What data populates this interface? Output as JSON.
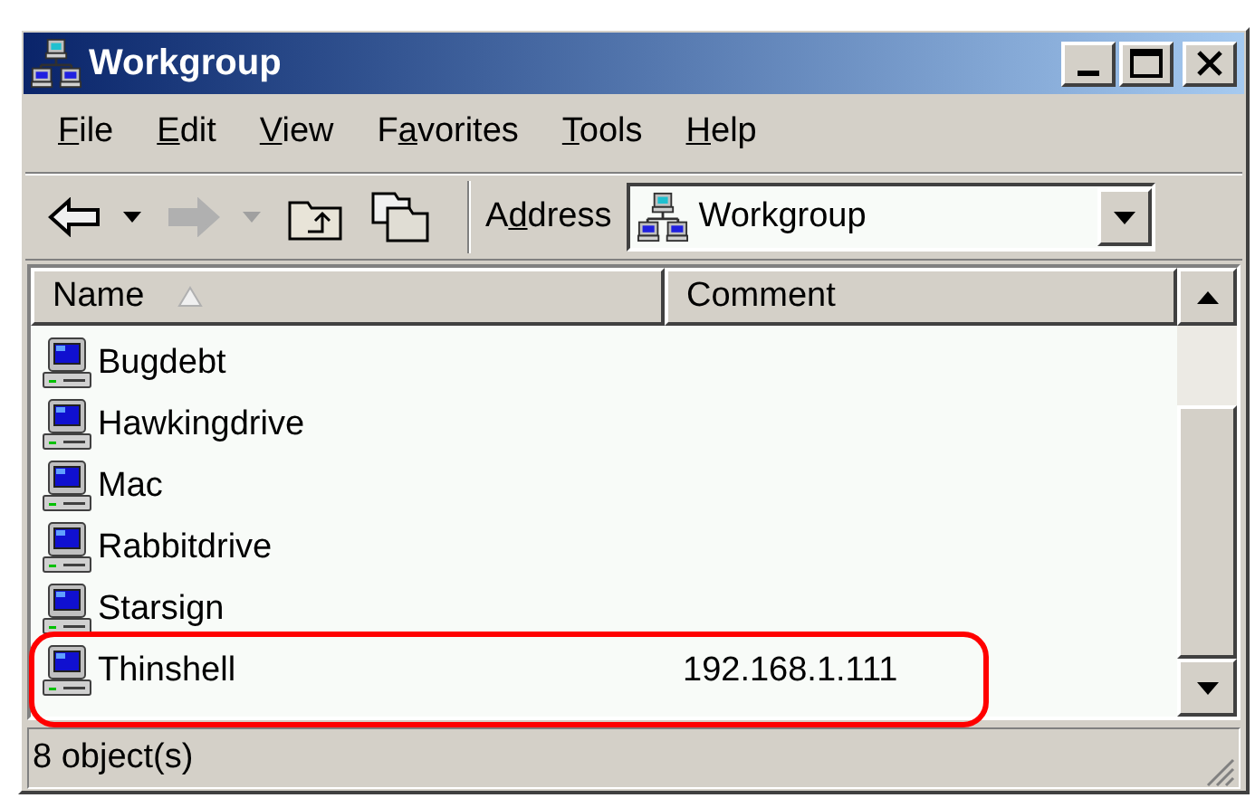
{
  "window": {
    "title": "Workgroup"
  },
  "menu": [
    {
      "key": "F",
      "rest": "ile"
    },
    {
      "key": "E",
      "rest": "dit"
    },
    {
      "key": "V",
      "rest": "iew"
    },
    {
      "start": "F",
      "key": "a",
      "rest": "vorites"
    },
    {
      "key": "T",
      "rest": "ools"
    },
    {
      "key": "H",
      "rest": "elp"
    }
  ],
  "toolbar": [
    {
      "kind": "back",
      "disabled": false
    },
    {
      "kind": "forward",
      "disabled": true
    },
    {
      "kind": "up",
      "disabled": false
    },
    {
      "kind": "folders",
      "disabled": false
    }
  ],
  "address": {
    "label": {
      "start": "A",
      "key": "d",
      "rest": "dress"
    },
    "value": "Workgroup"
  },
  "list": {
    "columns": [
      {
        "label": "Name",
        "sorted": true
      },
      {
        "label": "Comment",
        "sorted": false
      }
    ],
    "rows": [
      {
        "name": "Bugdebt",
        "highlighted": false
      },
      {
        "name": "Hawkingdrive",
        "highlighted": false
      },
      {
        "name": "Mac",
        "highlighted": false
      },
      {
        "name": "Rabbitdrive",
        "highlighted": false
      },
      {
        "name": "Starsign",
        "highlighted": false
      },
      {
        "name": "Thinshell",
        "comment": "192.168.1.111",
        "highlighted": true
      }
    ]
  },
  "status_bar": {
    "text": "8 object(s)"
  }
}
